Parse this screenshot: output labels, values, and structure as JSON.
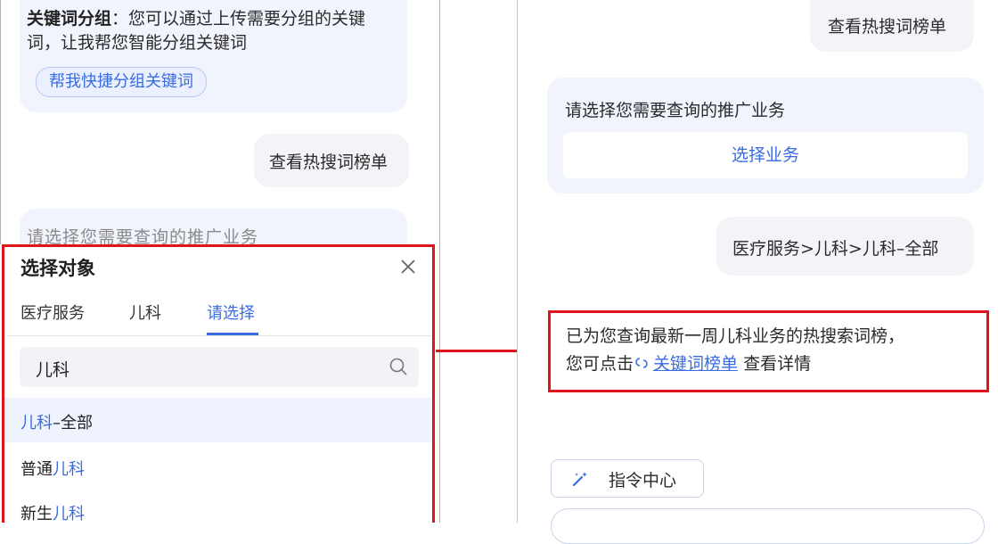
{
  "left": {
    "keyword_group": {
      "title": "关键词分组",
      "line1_rest": "：您可以通过上传需要分组的关键",
      "line2": "词，让我帮您智能分组关键词",
      "chip": "帮我快捷分组关键词"
    },
    "user_msg": "查看热搜词榜单",
    "peek_text": "请选择您需要查询的推广业务",
    "sheet": {
      "title": "选择对象",
      "tabs": [
        "医疗服务",
        "儿科",
        "请选择"
      ],
      "search_value": "儿科",
      "options": [
        {
          "pre": "",
          "hl": "儿科",
          "post": "–全部"
        },
        {
          "pre": "普通",
          "hl": "儿科",
          "post": ""
        },
        {
          "pre": "新生",
          "hl": "儿科",
          "post": ""
        }
      ]
    }
  },
  "right": {
    "user_msg1": "查看热搜词榜单",
    "bot_prompt": "请选择您需要查询的推广业务",
    "select_button": "选择业务",
    "user_msg2": "医疗服务>儿科>儿科–全部",
    "result_line1": "已为您查询最新一周儿科业务的热搜索词榜，",
    "result_line2_pre": "您可点击",
    "result_link": "关键词榜单",
    "result_line2_post": " 查看详情",
    "command_center": "指令中心"
  },
  "colors": {
    "accent": "#3a6be0",
    "highlight_border": "#e0151c",
    "bot_bubble": "#f1f4fc"
  }
}
